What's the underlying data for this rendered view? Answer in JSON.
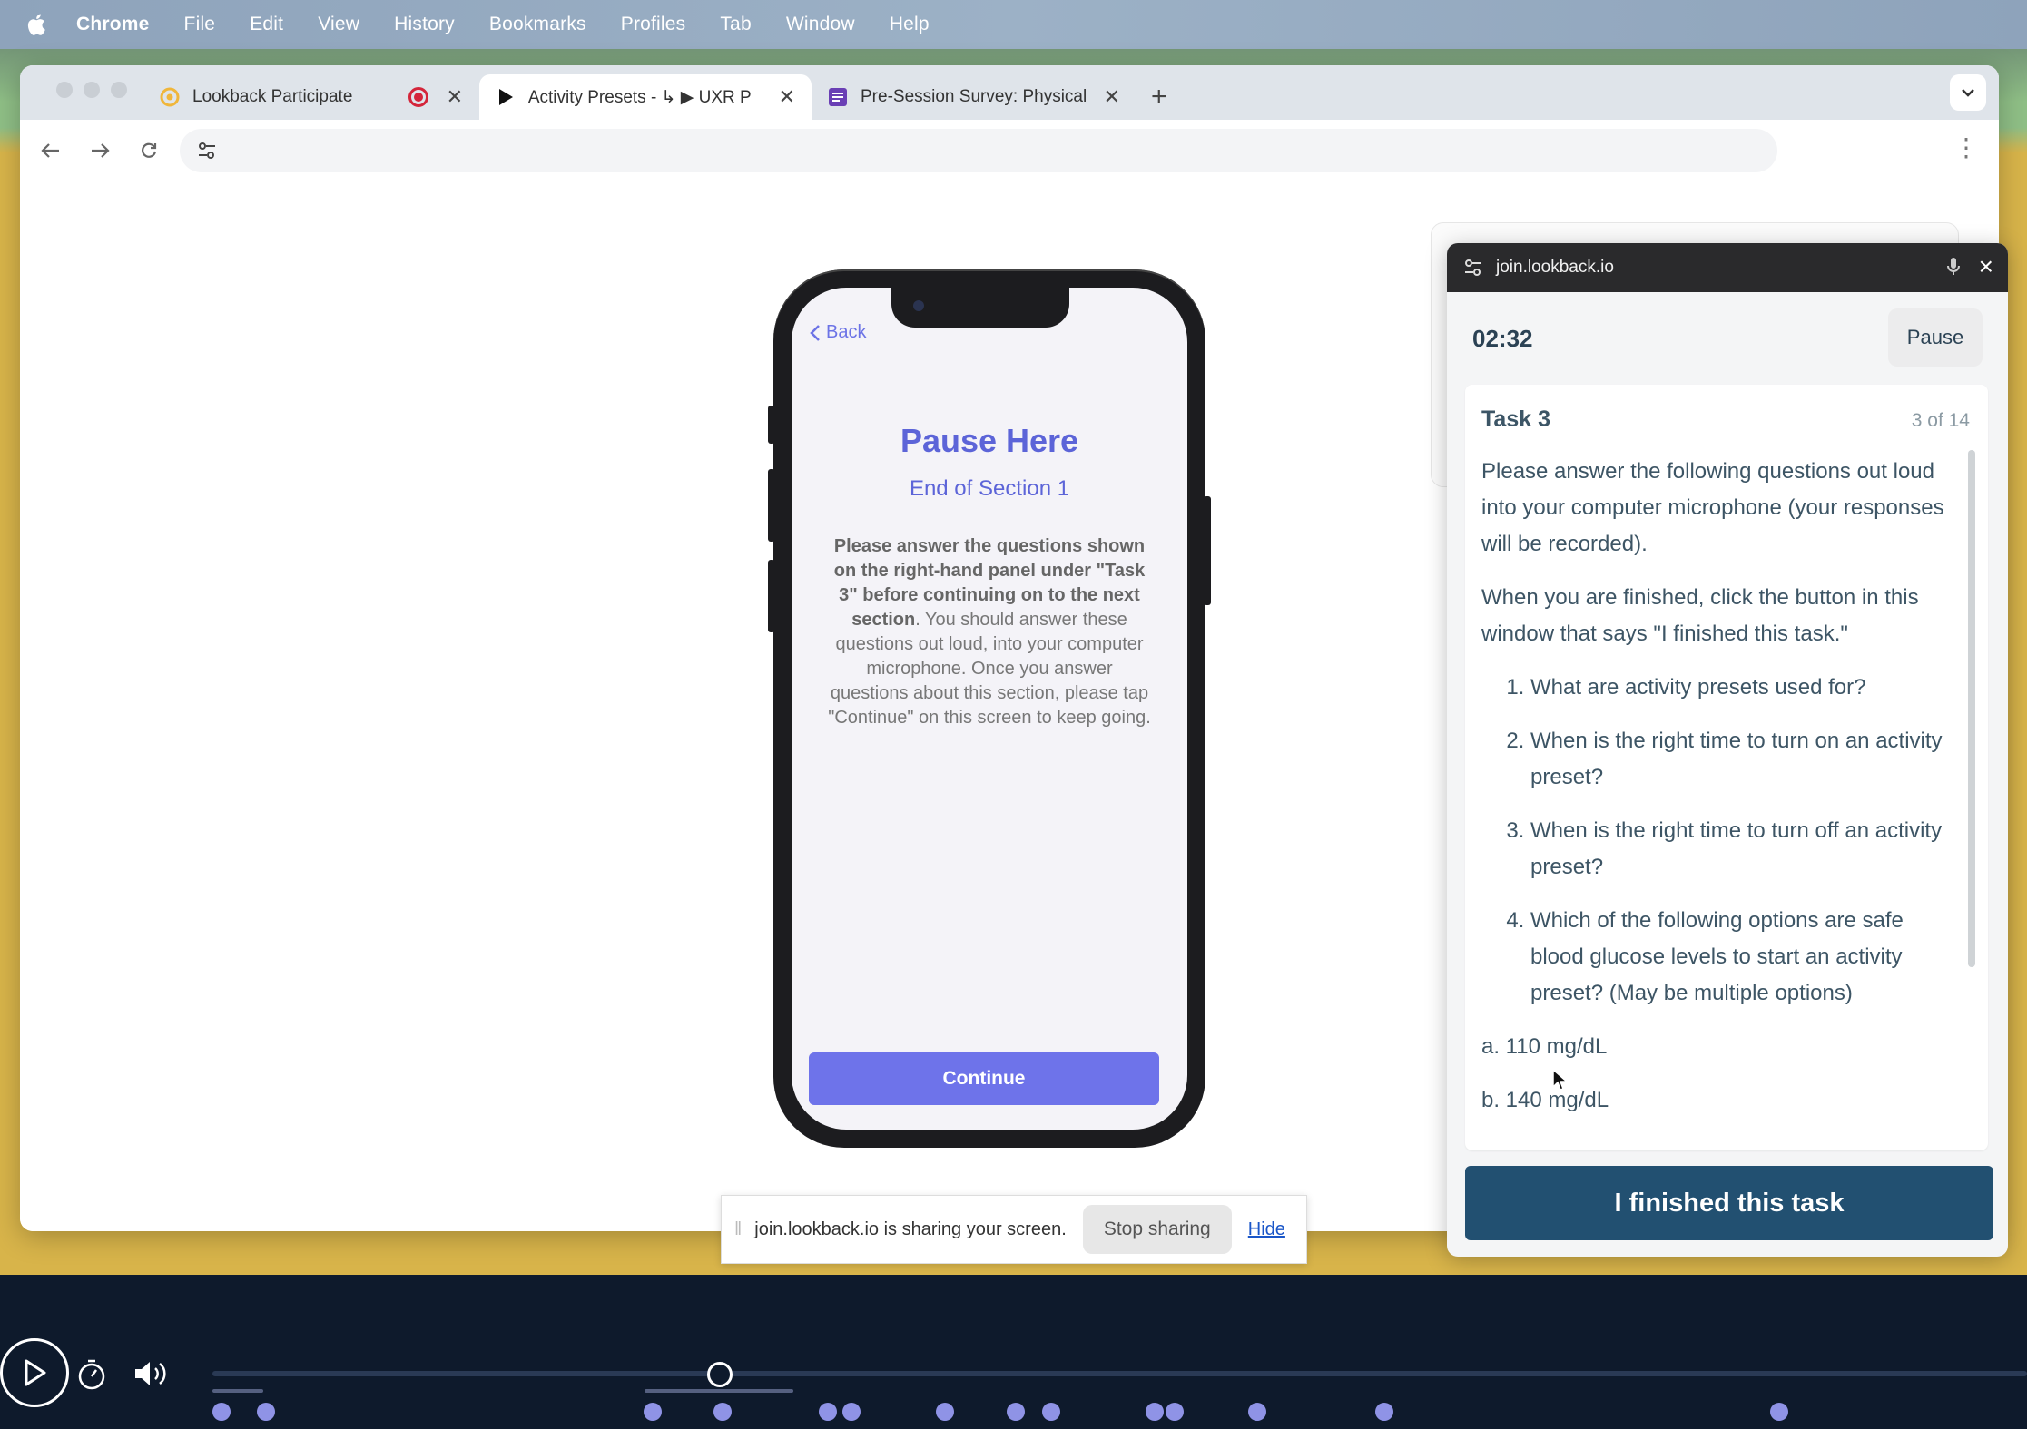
{
  "menubar": {
    "app": "Chrome",
    "items": [
      "File",
      "Edit",
      "View",
      "History",
      "Bookmarks",
      "Profiles",
      "Tab",
      "Window",
      "Help"
    ]
  },
  "tabs": [
    {
      "label": "Lookback Participate",
      "icon": "lookback-logo-icon",
      "recording": true
    },
    {
      "label": "Activity Presets - ↳ ▶ UXR P",
      "icon": "play-icon",
      "active": true
    },
    {
      "label": "Pre-Session Survey: Physical",
      "icon": "form-icon"
    }
  ],
  "address_bar": {
    "value": ""
  },
  "phone": {
    "back_label": "Back",
    "title": "Pause Here",
    "subtitle": "End of Section 1",
    "body_bold": "Please answer the questions shown on the right-hand panel under \"Task 3\" before continuing on to the next section",
    "body_rest": ". You should answer these questions out loud, into your computer microphone. Once you answer questions about this section, please tap \"Continue\" on this screen to keep going.",
    "continue_label": "Continue"
  },
  "lookback": {
    "header_url": "join.lookback.io",
    "timer": "02:32",
    "pause_label": "Pause",
    "task_title": "Task 3",
    "task_count": "3 of 14",
    "intro": "Please answer the following questions out loud into your computer microphone (your responses will be recorded).",
    "instructions": "When you are finished, click the button in this window that says \"I finished this task.\"",
    "questions": [
      "What are activity presets used for?",
      "When is the right time to turn on an activity preset?",
      "When is the right time to turn off an activity preset?",
      "Which of the following options are safe blood glucose levels to start an activity preset? (May be multiple options)"
    ],
    "options": [
      "a. 110 mg/dL",
      "b. 140 mg/dL"
    ],
    "finish_label": "I finished this task"
  },
  "sharebar": {
    "message": "join.lookback.io is sharing your screen.",
    "stop_label": "Stop sharing",
    "hide_label": "Hide"
  },
  "player": {
    "progress": 0.28,
    "marker_count": 17
  }
}
